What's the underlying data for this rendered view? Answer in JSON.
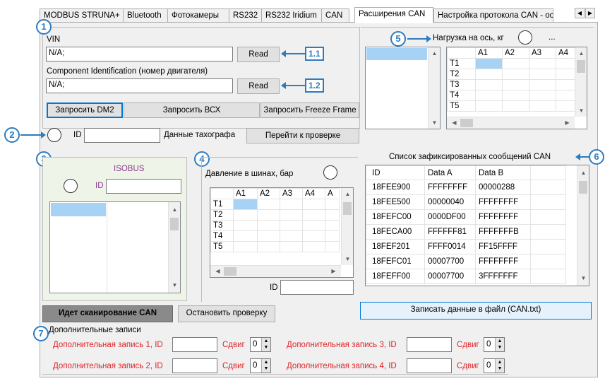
{
  "tabs": [
    "MODBUS STRUNA+",
    "Bluetooth",
    "Фотокамеры",
    "RS232",
    "RS232 Iridium",
    "CAN",
    "Расширения CAN",
    "Настройка протокола CAN - основ"
  ],
  "active_tab": "Расширения CAN",
  "callouts": {
    "c1": "1",
    "c2": "2",
    "c3": "3",
    "c4": "4",
    "c5": "5",
    "c6": "6",
    "c7": "7",
    "t11": "1.1",
    "t12": "1.2"
  },
  "vin": {
    "label": "VIN",
    "value": "N/A;",
    "read": "Read"
  },
  "component": {
    "label": "Component Identification (номер двигателя)",
    "value": "N/A;",
    "read": "Read"
  },
  "buttons": {
    "dm2": "Запросить DM2",
    "bcx": "Запросить ВСХ",
    "freeze": "Запросить Freeze Frame",
    "goto_check": "Перейти к проверке",
    "scanning": "Идет сканирование CAN",
    "stop_check": "Остановить проверку",
    "write_file": "Записать данные в файл (CAN.txt)"
  },
  "tacho": {
    "id_label": "ID",
    "data_label": "Данные тахографа",
    "id_value": ""
  },
  "isobus": {
    "title": "ISOBUS",
    "id_label": "ID",
    "id_value": ""
  },
  "axle": {
    "title": "Нагрузка на ось, кг",
    "extra": "...",
    "cols": [
      "A1",
      "A2",
      "A3",
      "A4"
    ],
    "rows": [
      "T1",
      "T2",
      "T3",
      "T4",
      "T5"
    ]
  },
  "tire": {
    "title": "Давление в шинах, бар",
    "cols": [
      "A1",
      "A2",
      "A3",
      "A4",
      "A"
    ],
    "rows": [
      "T1",
      "T2",
      "T3",
      "T4",
      "T5"
    ],
    "id_label": "ID",
    "id_value": ""
  },
  "can_list": {
    "title": "Список зафиксированных сообщений CAN",
    "headers": [
      "ID",
      "Data A",
      "Data B"
    ],
    "rows": [
      [
        "18FEE900",
        "FFFFFFFF",
        "00000288"
      ],
      [
        "18FEE500",
        "00000040",
        "FFFFFFFF"
      ],
      [
        "18FEFC00",
        "0000DF00",
        "FFFFFFFF"
      ],
      [
        "18FECA00",
        "FFFFFF81",
        "FFFFFFFB"
      ],
      [
        "18FEF201",
        "FFFF0014",
        "FF15FFFF"
      ],
      [
        "18FEFC01",
        "00007700",
        "FFFFFFFF"
      ],
      [
        "18FEFF00",
        "00007700",
        "3FFFFFFF"
      ]
    ]
  },
  "extra": {
    "title": "Дополнительные записи",
    "shift_label": "Сдвиг",
    "records": [
      {
        "label": "Дополнительная запись 1, ID",
        "id": "",
        "shift": "0"
      },
      {
        "label": "Дополнительная запись 2, ID",
        "id": "",
        "shift": "0"
      },
      {
        "label": "Дополнительная запись 3, ID",
        "id": "",
        "shift": "0"
      },
      {
        "label": "Дополнительная запись 4, ID",
        "id": "",
        "shift": "0"
      }
    ]
  },
  "colors": {
    "accent": "#2e7bbf",
    "selection": "#a6d2f5",
    "red_text": "#e0262a",
    "isobus_purple": "#8b3a8f",
    "isobus_bg": "#eef5e8"
  }
}
